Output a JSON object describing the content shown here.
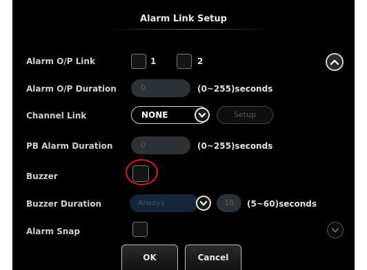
{
  "dialog": {
    "title": "Alarm Link Setup"
  },
  "rows": {
    "alarm_op_link": {
      "label": "Alarm O/P Link",
      "option1": "1",
      "option2": "2"
    },
    "alarm_op_duration": {
      "label": "Alarm O/P Duration",
      "value": "0",
      "unit": "(0~255)seconds"
    },
    "channel_link": {
      "label": "Channel Link",
      "selected": "NONE",
      "setup_label": "Setup"
    },
    "pb_alarm_duration": {
      "label": "PB Alarm Duration",
      "value": "0",
      "unit": "(0~255)seconds"
    },
    "buzzer": {
      "label": "Buzzer"
    },
    "buzzer_duration": {
      "label": "Buzzer Duration",
      "selected": "Always",
      "value": "10",
      "unit": "(5~60)seconds"
    },
    "alarm_snap": {
      "label": "Alarm Snap"
    }
  },
  "buttons": {
    "ok": "OK",
    "cancel": "Cancel"
  },
  "icons": {
    "scroll_up": "chevron-up-icon",
    "scroll_down": "chevron-down-icon",
    "dropdown": "chevron-down-icon"
  },
  "colors": {
    "highlight": "#e01818",
    "field": "#2c3136",
    "disabled_field": "#16263a"
  }
}
